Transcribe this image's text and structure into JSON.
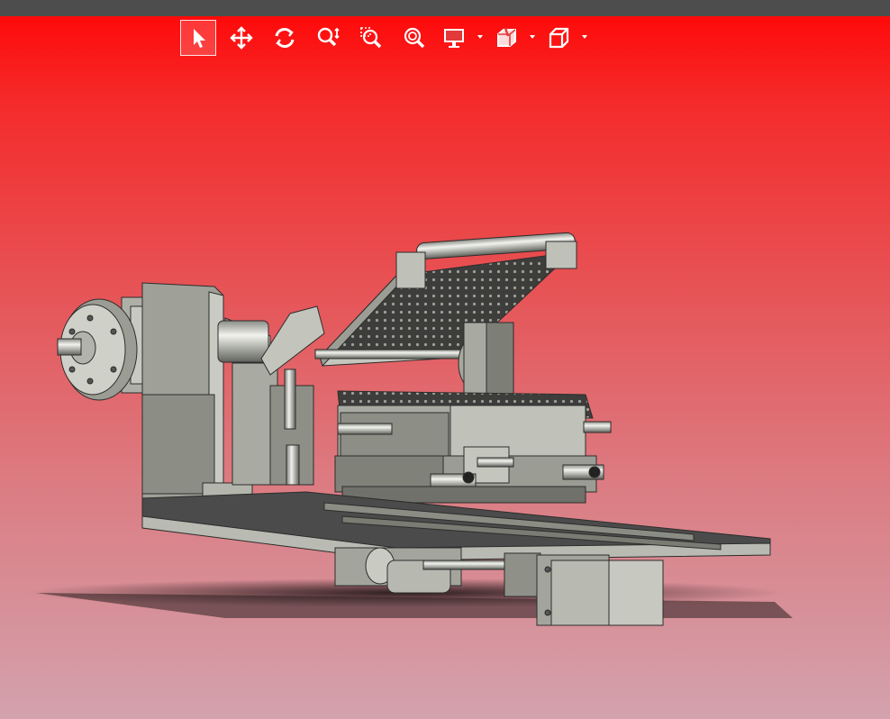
{
  "toolbar": {
    "tools": [
      {
        "icon": "select-arrow-icon",
        "active": true
      },
      {
        "icon": "pan-icon"
      },
      {
        "icon": "rotate-icon"
      },
      {
        "icon": "zoom-updown-icon"
      },
      {
        "icon": "zoom-box-icon"
      },
      {
        "icon": "zoom-fit-icon"
      },
      {
        "icon": "display-mode-icon",
        "dropdown": true
      },
      {
        "icon": "section-view-icon",
        "dropdown": true
      },
      {
        "icon": "view-orientation-cube-icon",
        "dropdown": true
      }
    ]
  },
  "colors": {
    "topbar": "#4d4d4d",
    "bg_top": "#ff0a0a",
    "bg_bottom": "#d3a2ad",
    "metal": "#b9bbb3",
    "metal_dark": "#6e7068",
    "plate": "#4a4b4a"
  }
}
